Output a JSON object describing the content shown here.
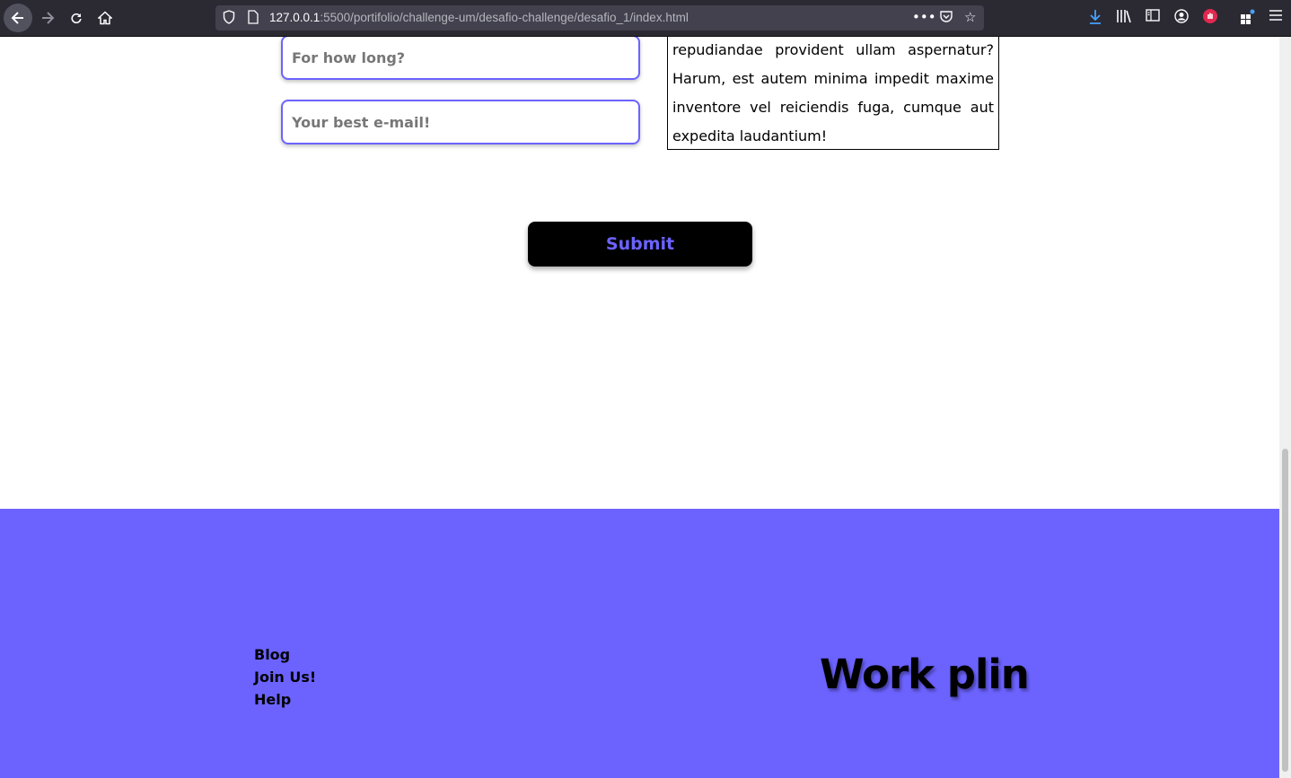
{
  "browser": {
    "url_host": "127.0.0.1",
    "url_path": ":5500/portifolio/challenge-um/desafio-challenge/desafio_1/index.html"
  },
  "form": {
    "duration_placeholder": "For how long?",
    "email_placeholder": "Your best e-mail!",
    "message_text": "repudiandae provident ullam aspernatur? Harum, est autem minima impedit maxime inventore vel reiciendis fuga, cumque aut expedita laudantium!",
    "submit_label": "Submit"
  },
  "footer": {
    "links": [
      "Blog",
      "Join Us!",
      "Help"
    ],
    "brand": "Work plin"
  },
  "colors": {
    "accent": "#6c63ff",
    "footer_bg": "#6c63ff",
    "toolbar_bg": "#2b2a33"
  }
}
